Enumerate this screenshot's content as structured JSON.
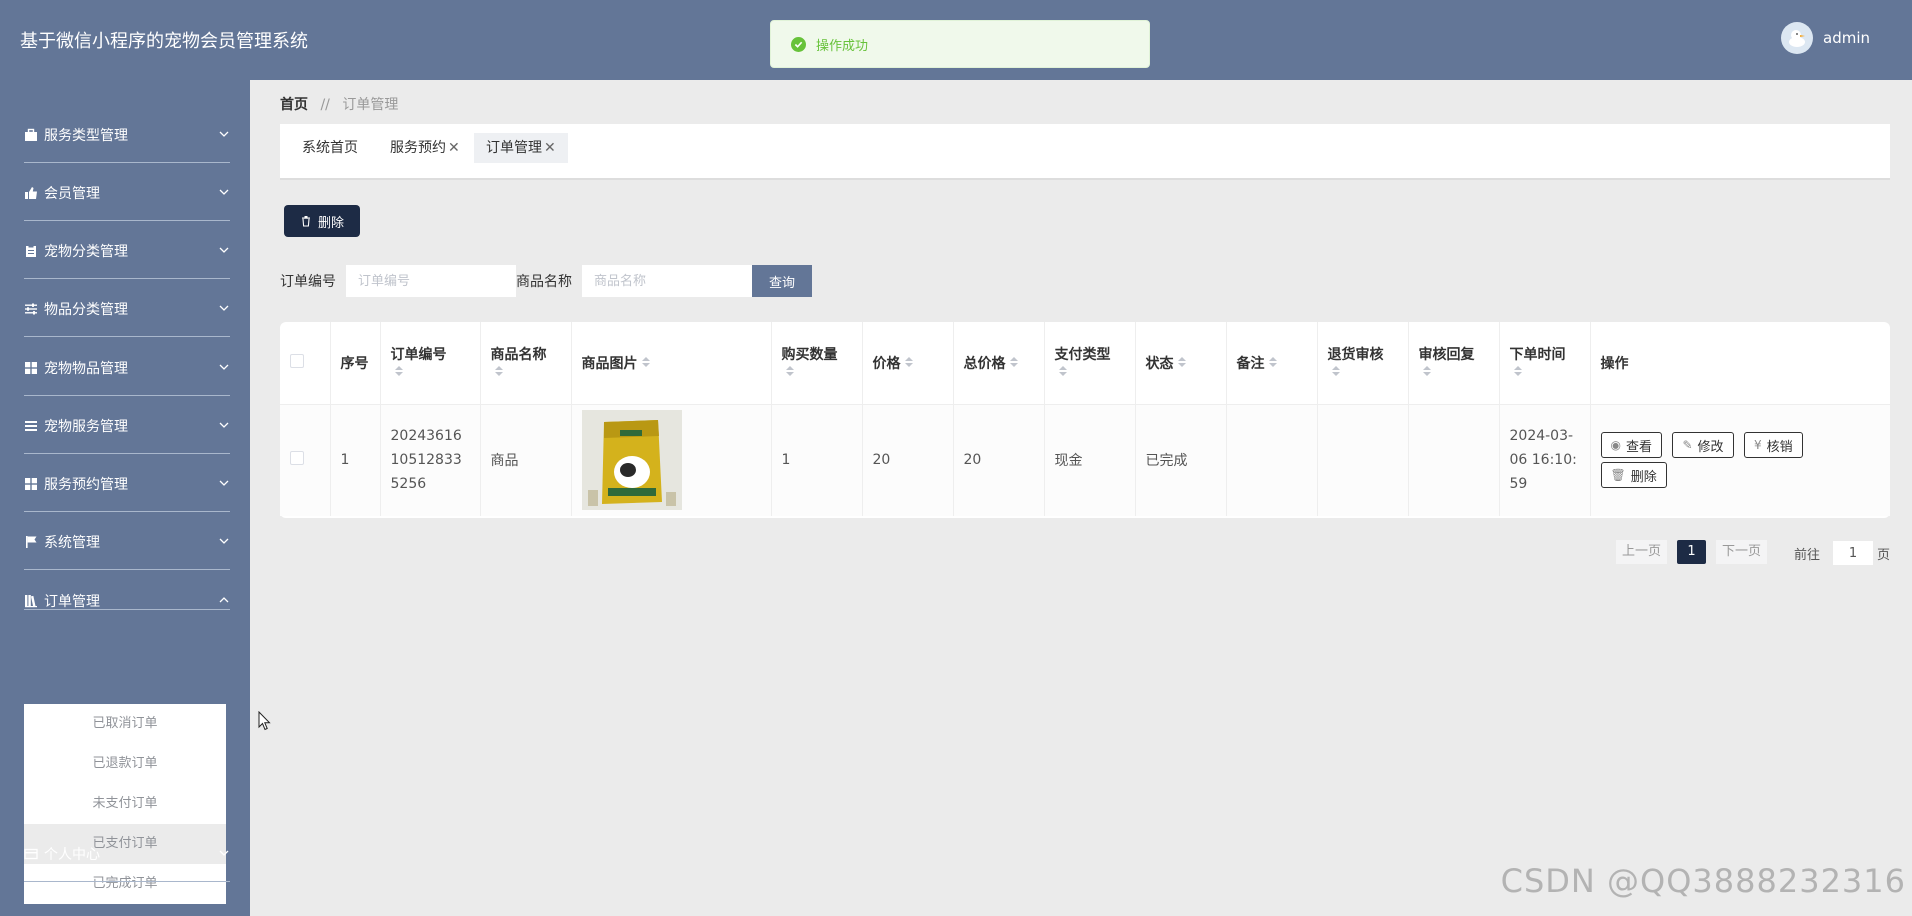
{
  "header": {
    "title": "基于微信小程序的宠物会员管理系统",
    "user_name": "admin"
  },
  "toast": {
    "message": "操作成功"
  },
  "sidebar": {
    "items": [
      {
        "label": "服务类型管理",
        "icon": "briefcase-icon"
      },
      {
        "label": "会员管理",
        "icon": "thumbs-up-icon"
      },
      {
        "label": "宠物分类管理",
        "icon": "clipboard-icon"
      },
      {
        "label": "物品分类管理",
        "icon": "sliders-icon"
      },
      {
        "label": "宠物物品管理",
        "icon": "grid-icon"
      },
      {
        "label": "宠物服务管理",
        "icon": "list-icon"
      },
      {
        "label": "服务预约管理",
        "icon": "grid-icon"
      },
      {
        "label": "系统管理",
        "icon": "flag-icon"
      },
      {
        "label": "订单管理",
        "icon": "library-icon"
      },
      {
        "label": "个人中心",
        "icon": "card-icon"
      }
    ],
    "submenu": [
      {
        "label": "已取消订单"
      },
      {
        "label": "已退款订单"
      },
      {
        "label": "未支付订单"
      },
      {
        "label": "已支付订单"
      },
      {
        "label": "已完成订单"
      }
    ]
  },
  "breadcrumb": {
    "home": "首页",
    "separator": "//",
    "current": "订单管理"
  },
  "tabs": [
    {
      "label": "系统首页"
    },
    {
      "label": "服务预约"
    },
    {
      "label": "订单管理"
    }
  ],
  "toolbar": {
    "delete_label": "删除"
  },
  "search": {
    "order_no_label": "订单编号",
    "order_no_placeholder": "订单编号",
    "product_label": "商品名称",
    "product_placeholder": "商品名称",
    "query_label": "查询"
  },
  "table": {
    "columns": [
      "序号",
      "订单编号",
      "商品名称",
      "商品图片",
      "购买数量",
      "价格",
      "总价格",
      "支付类型",
      "状态",
      "备注",
      "退货审核",
      "审核回复",
      "下单时间",
      "操作"
    ],
    "rows": [
      {
        "index": "1",
        "order_no": "20243616105128335256",
        "product_name": "商品",
        "quantity": "1",
        "price": "20",
        "total": "20",
        "pay_type": "现金",
        "status": "已完成",
        "remark": "",
        "return_review": "",
        "review_reply": "",
        "order_time": "2024-03-06 16:10:59",
        "actions": {
          "view": "查看",
          "edit": "修改",
          "verify": "核销",
          "delete": "删除"
        }
      }
    ]
  },
  "pagination": {
    "prev": "上一页",
    "current": "1",
    "next": "下一页",
    "goto": "前往",
    "goto_value": "1",
    "unit": "页"
  },
  "watermark": "CSDN @QQ3888232316",
  "colors": {
    "primary": "#637697",
    "dark": "#1d2b45",
    "success": "#67c23a"
  }
}
